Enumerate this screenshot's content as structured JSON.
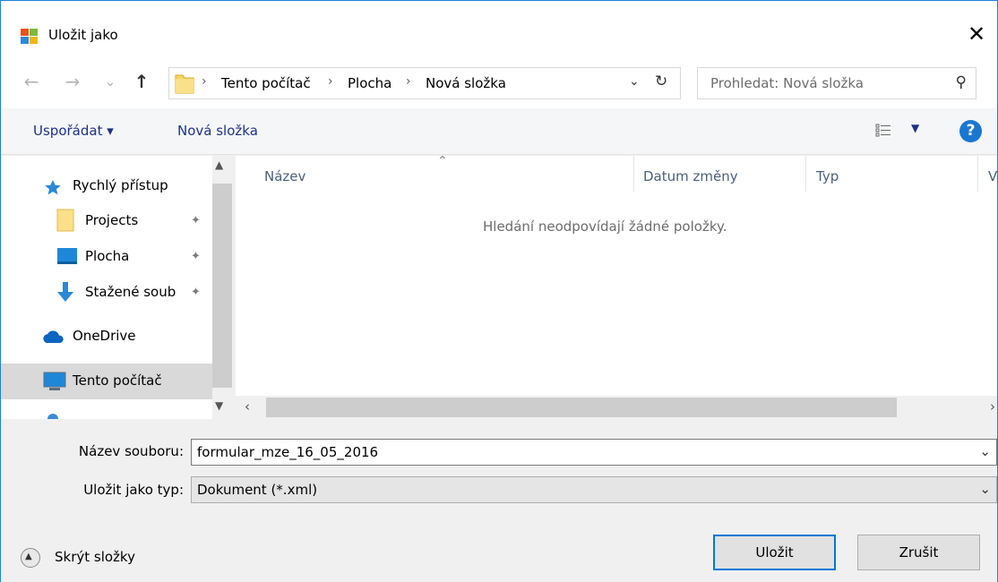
{
  "window": {
    "title": "Uložit jako",
    "close_glyph": "✕"
  },
  "address": {
    "back_glyph": "←",
    "forward_glyph": "→",
    "recent_glyph": "⌄",
    "up_glyph": "↑",
    "sep_glyph": "›",
    "breadcrumbs": [
      "Tento počítač",
      "Plocha",
      "Nová složka"
    ],
    "dropdown_glyph": "⌄",
    "refresh_glyph": "↻"
  },
  "search": {
    "placeholder": "Prohledat: Nová složka",
    "icon_glyph": "⚲"
  },
  "toolbar": {
    "organize_label": "Uspořádat ▾",
    "new_folder_label": "Nová složka",
    "view_dd_glyph": "▼",
    "help_glyph": "?"
  },
  "nav": {
    "quick_access": "Rychlý přístup",
    "items": [
      {
        "label": "Projects",
        "pinned": true
      },
      {
        "label": "Plocha",
        "pinned": true
      },
      {
        "label": "Stažené soub",
        "pinned": true
      }
    ],
    "onedrive": "OneDrive",
    "this_pc": "Tento počítač",
    "pin_glyph": "📌"
  },
  "filelist": {
    "columns": [
      "Název",
      "Datum změny",
      "Typ",
      "V"
    ],
    "empty_message": "Hledání neodpovídají žádné položky."
  },
  "fields": {
    "filename_label": "Název souboru:",
    "filename_value": "formular_mze_16_05_2016",
    "type_label": "Uložit jako typ:",
    "type_value": "Dokument (*.xml)"
  },
  "footer": {
    "hide_folders": "Skrýt složky",
    "save_button": "Uložit",
    "cancel_button": "Zrušit"
  },
  "colors": {
    "accent": "#0078d7",
    "link": "#1e3287",
    "selection": "#d9d9d9"
  }
}
